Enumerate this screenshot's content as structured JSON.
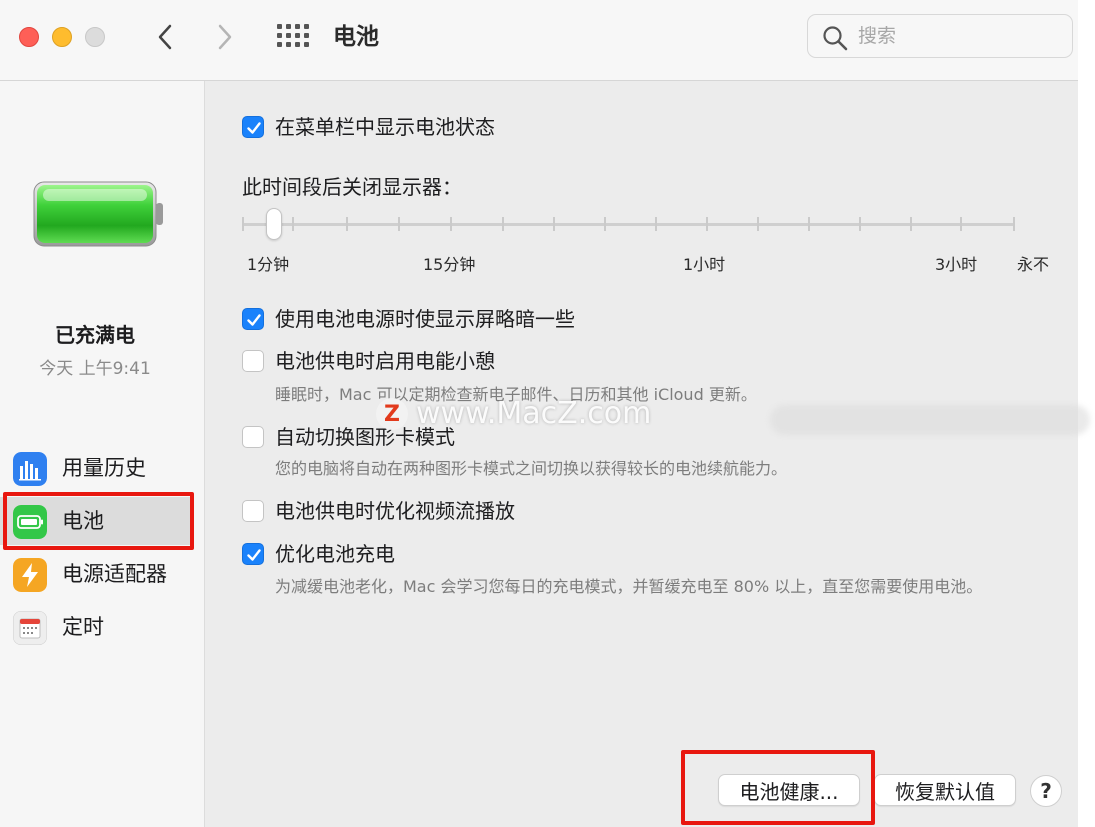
{
  "window": {
    "title": "电池",
    "search_placeholder": "搜索"
  },
  "sidebar": {
    "status_title": "已充满电",
    "status_time": "今天 上午9:41",
    "items": [
      {
        "label": "用量历史",
        "icon": "usage-history-icon",
        "color": "#2f80f0"
      },
      {
        "label": "电池",
        "icon": "battery-icon",
        "color": "#33c748"
      },
      {
        "label": "电源适配器",
        "icon": "power-adapter-icon",
        "color": "#f5a623"
      },
      {
        "label": "定时",
        "icon": "schedule-calendar-icon",
        "color": "#e5453a"
      }
    ],
    "selected_index": 1
  },
  "main": {
    "show_in_menubar": {
      "label": "在菜单栏中显示电池状态",
      "checked": true
    },
    "display_off": {
      "label": "此时间段后关闭显示器：",
      "tick_labels": [
        "1分钟",
        "15分钟",
        "1小时",
        "3小时",
        "永不"
      ],
      "selected": "1分钟"
    },
    "options": [
      {
        "label": "使用电池电源时使显示屏略暗一些",
        "checked": true,
        "desc": ""
      },
      {
        "label": "电池供电时启用电能小憩",
        "checked": false,
        "desc": "睡眠时，Mac 可以定期检查新电子邮件、日历和其他 iCloud 更新。"
      },
      {
        "label": "自动切换图形卡模式",
        "checked": false,
        "desc": "您的电脑将自动在两种图形卡模式之间切换以获得较长的电池续航能力。"
      },
      {
        "label": "电池供电时优化视频流播放",
        "checked": false,
        "desc": ""
      },
      {
        "label": "优化电池充电",
        "checked": true,
        "desc": "为减缓电池老化，Mac 会学习您每日的充电模式，并暂缓充电至 80% 以上，直至您需要使用电池。"
      }
    ],
    "buttons": {
      "battery_health": "电池健康...",
      "restore_defaults": "恢复默认值",
      "help": "?"
    }
  },
  "watermark": {
    "logo": "Z",
    "text": "www.MacZ.com"
  },
  "colors": {
    "accent": "#1a82fb",
    "highlight_box": "#e8170f",
    "battery_fill": "#3fd13a"
  }
}
